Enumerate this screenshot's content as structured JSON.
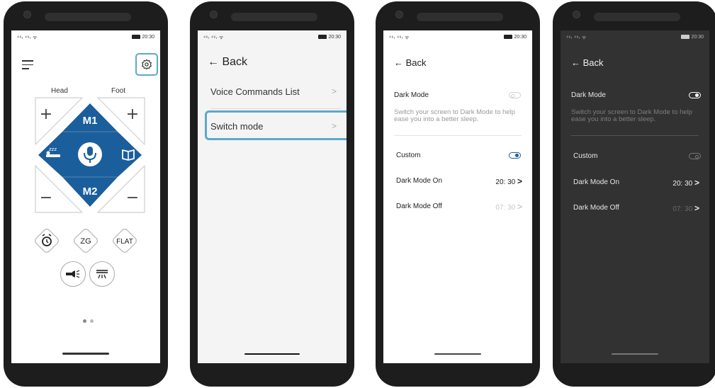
{
  "status_bar": {
    "signal": "⁴⁶ₗ ⁴⁶ₗ ᯤ",
    "time": "20:30"
  },
  "screen1": {
    "head_label": "Head",
    "foot_label": "Foot",
    "preset_top": "M1",
    "preset_bottom": "M2",
    "plus": "+",
    "minus": "−",
    "zzz": "zzz",
    "buttons": {
      "zg": "ZG",
      "flat": "FLAT"
    }
  },
  "screen2": {
    "back": "← Back",
    "voice_commands": "Voice Commands List",
    "switch_mode": "Switch mode",
    "chevron": ">"
  },
  "settings": {
    "back": "← Back",
    "dark_mode": "Dark Mode",
    "description": "Switch your screen to Dark Mode to help ease you into a better sleep.",
    "custom": "Custom",
    "dark_mode_on": "Dark Mode On",
    "dark_mode_on_time": "20: 30",
    "dark_mode_off": "Dark Mode Off",
    "dark_mode_off_time": "07: 30",
    "chevron": ">"
  },
  "screen3_toggles": {
    "dark_mode": false,
    "custom": true
  },
  "screen4_toggles": {
    "dark_mode": true,
    "custom": false
  },
  "colors": {
    "accent": "#5ea9c7",
    "control_blue": "#1b5e9c",
    "dark_bg": "#323232"
  }
}
